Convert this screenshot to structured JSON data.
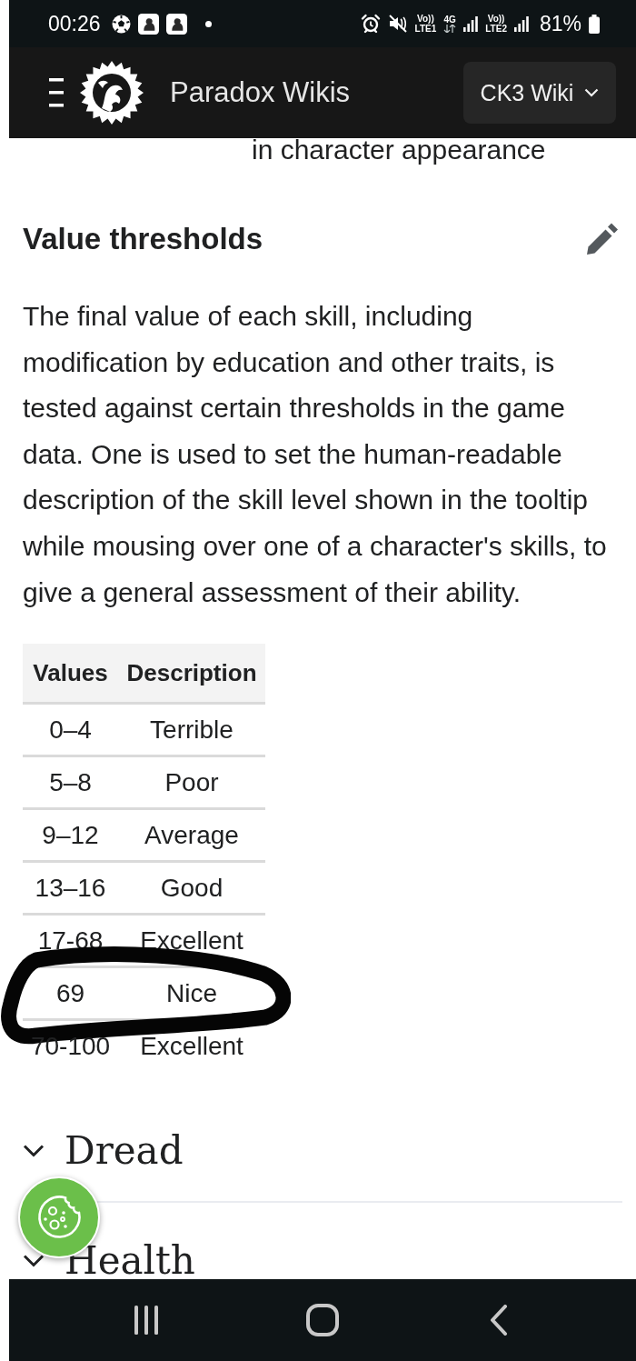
{
  "status_bar": {
    "time": "00:26",
    "indicators": [
      {
        "kind": "volte",
        "label": "Vo))",
        "sub": "LTE1"
      },
      {
        "kind": "data",
        "label": "4G"
      },
      {
        "kind": "signal"
      },
      {
        "kind": "volte",
        "label": "Vo))",
        "sub": "LTE2"
      },
      {
        "kind": "signal"
      }
    ],
    "battery": "81%"
  },
  "header": {
    "site_title": "Paradox Wikis",
    "wiki_selector": "CK3 Wiki"
  },
  "article": {
    "fragment": "in character appearance",
    "section_title": "Value thresholds",
    "paragraph": "The final value of each skill, including modification by education and other traits, is tested against certain thresholds in the game data. One is used to set the human-readable description of the skill level shown in the tooltip while mousing over one of a character's skills, to give a general assessment of their ability.",
    "table": {
      "columns": [
        "Values",
        "Description"
      ],
      "rows": [
        {
          "cells": [
            "0–4",
            "Terrible"
          ],
          "circled": false
        },
        {
          "cells": [
            "5–8",
            "Poor"
          ],
          "circled": false
        },
        {
          "cells": [
            "9–12",
            "Average"
          ],
          "circled": false
        },
        {
          "cells": [
            "13–16",
            "Good"
          ],
          "circled": false
        },
        {
          "cells": [
            "17-68",
            "Excellent"
          ],
          "circled": false
        },
        {
          "cells": [
            "69",
            "Nice"
          ],
          "circled": true
        },
        {
          "cells": [
            "70-100",
            "Excellent"
          ],
          "circled": false
        }
      ]
    },
    "sections": [
      {
        "title": "Dread",
        "expanded": false
      },
      {
        "title": "Health",
        "expanded": false
      }
    ]
  }
}
